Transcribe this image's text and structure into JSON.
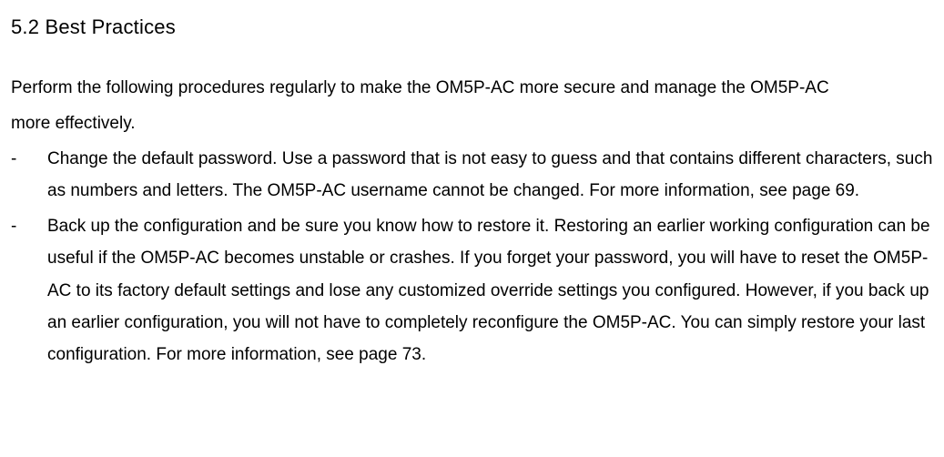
{
  "heading": "5.2 Best Practices",
  "intro1": "Perform the following procedures regularly to make the OM5P-AC more secure and manage the OM5P-AC",
  "intro2": "more effectively.",
  "items": [
    "Change the default password.  Use a password that is not easy to guess and that contains different characters, such as numbers  and letters. The OM5P-AC username cannot be changed. For more information, see page 69.",
    "Back up the configuration and be sure you know how to restore it. Restoring an earlier working configuration can be useful if the OM5P-AC becomes unstable or crashes. If you forget your password, you will have to reset the OM5P-AC to its factory default settings and lose any customized override settings you configured. However, if you back up an earlier configuration, you will not have to completely reconfigure the OM5P-AC. You can simply restore your last configuration. For more information, see page 73."
  ]
}
